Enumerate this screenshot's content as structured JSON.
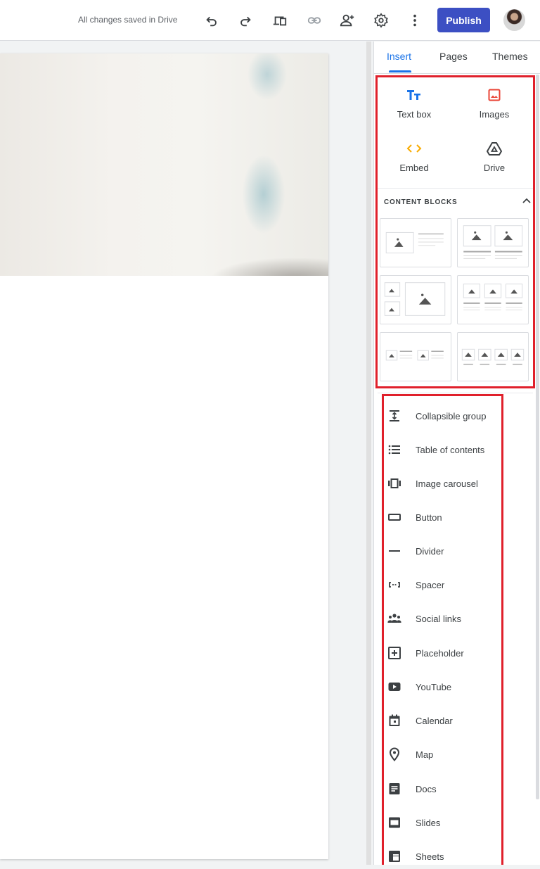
{
  "topbar": {
    "save_status": "All changes saved in Drive",
    "publish_label": "Publish",
    "icons": [
      "undo-icon",
      "redo-icon",
      "preview-icon",
      "link-icon",
      "share-icon",
      "settings-icon",
      "more-icon"
    ]
  },
  "panel": {
    "tabs": [
      "Insert",
      "Pages",
      "Themes"
    ],
    "active_tab": "Insert",
    "insert_items": [
      "Text box",
      "Images",
      "Embed",
      "Drive"
    ],
    "content_blocks_heading": "CONTENT BLOCKS",
    "components": [
      "Collapsible group",
      "Table of contents",
      "Image carousel",
      "Button",
      "Divider",
      "Spacer",
      "Social links",
      "Placeholder",
      "YouTube",
      "Calendar",
      "Map",
      "Docs",
      "Slides",
      "Sheets"
    ]
  },
  "colors": {
    "accent": "#1a73e8",
    "publish": "#3c4fc3",
    "highlight": "#e0202b",
    "images_icon": "#ea4335",
    "embed_icon": "#f9ab00"
  }
}
